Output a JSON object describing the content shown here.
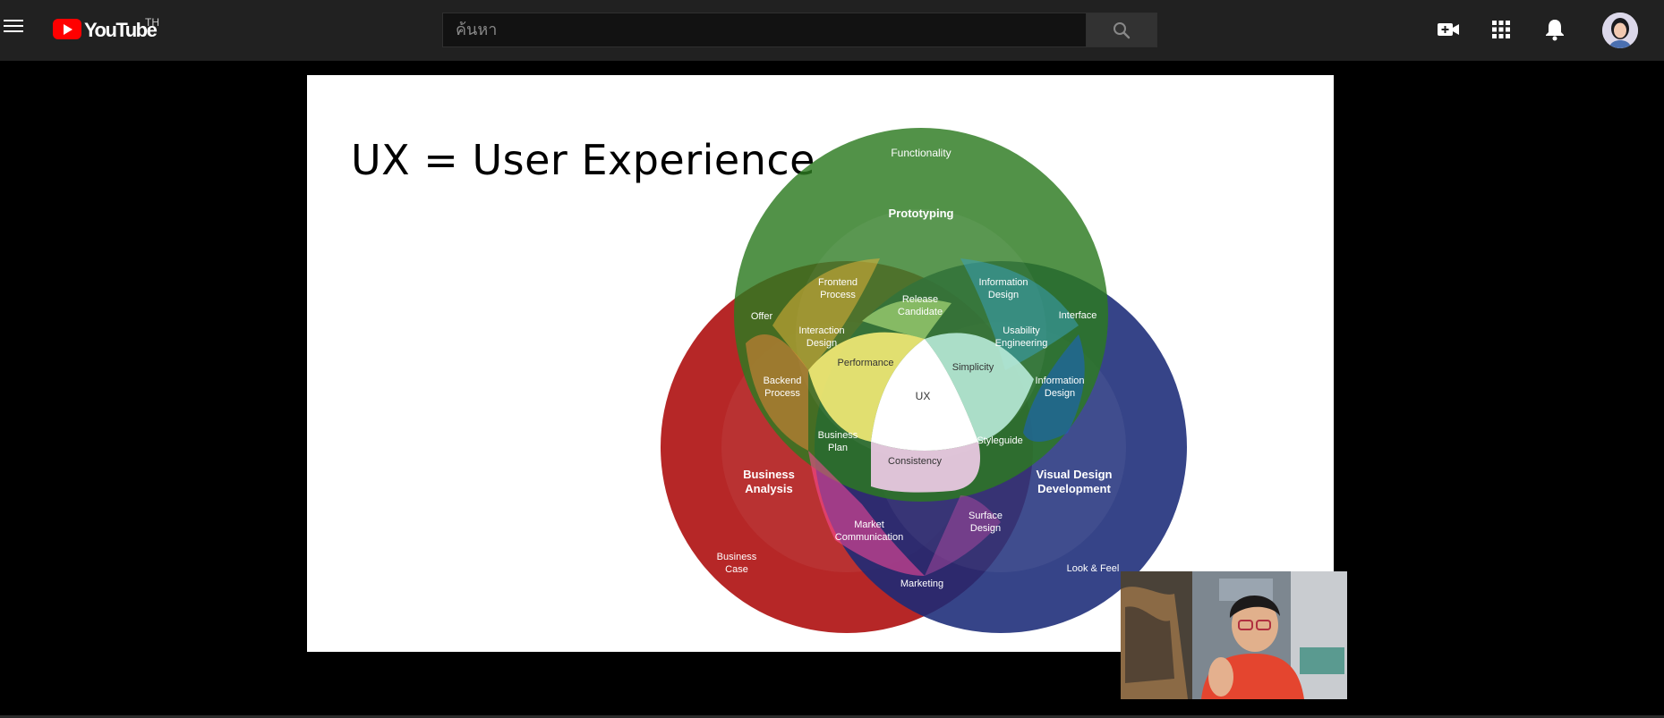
{
  "header": {
    "logo_text": "YouTube",
    "region": "TH",
    "search_placeholder": "ค้นหา",
    "icons": [
      "menu-icon",
      "create-video-icon",
      "apps-grid-icon",
      "notifications-bell-icon",
      "account-avatar"
    ]
  },
  "slide": {
    "title": "UX = User Experience",
    "venn": {
      "circles": [
        {
          "name": "Prototyping",
          "color": "#2c7a20"
        },
        {
          "name": "Business Analysis",
          "color": "#b01515"
        },
        {
          "name": "Visual Design Development",
          "color": "#1a2a78"
        }
      ],
      "labels": {
        "functionality": "Functionality",
        "prototyping": "Prototyping",
        "frontend_1": "Frontend",
        "frontend_2": "Process",
        "info_top_1": "Information",
        "info_top_2": "Design",
        "release_1": "Release",
        "release_2": "Candidate",
        "offer": "Offer",
        "interface": "Interface",
        "interaction_1": "Interaction",
        "interaction_2": "Design",
        "usability_1": "Usability",
        "usability_2": "Engineering",
        "performance": "Performance",
        "simplicity": "Simplicity",
        "backend_1": "Backend",
        "backend_2": "Process",
        "info_right_1": "Information",
        "info_right_2": "Design",
        "ux": "UX",
        "bizplan_1": "Business",
        "bizplan_2": "Plan",
        "styleguide": "Styleguide",
        "consistency": "Consistency",
        "business_analysis_1": "Business",
        "business_analysis_2": "Analysis",
        "visual_design_1": "Visual Design",
        "visual_design_2": "Development",
        "surface_1": "Surface",
        "surface_2": "Design",
        "market_1": "Market",
        "market_2": "Communication",
        "bizcase_1": "Business",
        "bizcase_2": "Case",
        "look_feel": "Look & Feel",
        "marketing": "Marketing"
      }
    }
  },
  "colors": {
    "header_bg": "#212121",
    "brand_red": "#ff0000",
    "green": "#2c7a20",
    "red": "#b01515",
    "blue": "#1a2a78"
  }
}
